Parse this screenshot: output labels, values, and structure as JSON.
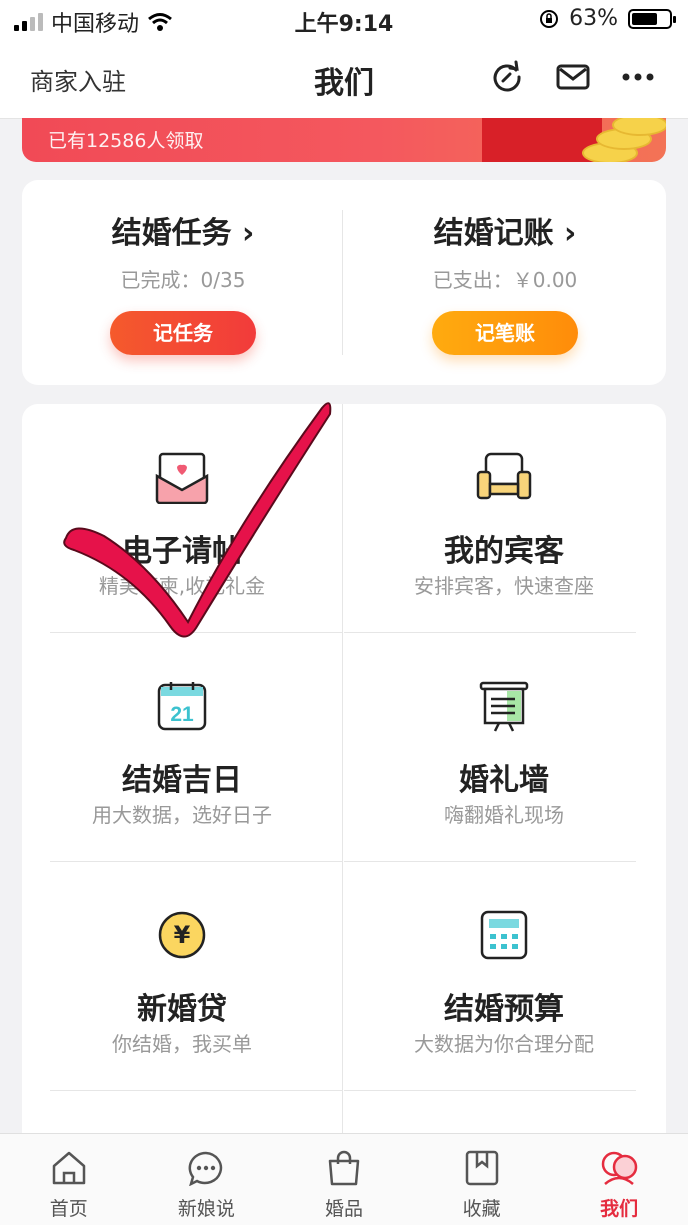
{
  "status_bar": {
    "carrier": "中国移动",
    "time": "上午9:14",
    "battery": "63%"
  },
  "nav": {
    "merchant": "商家入驻",
    "title": "我们"
  },
  "banner": {
    "text": "已有12586人领取"
  },
  "tasks": [
    {
      "title": "结婚任务",
      "sub": "已完成：0/35",
      "button": "记任务"
    },
    {
      "title": "结婚记账",
      "sub": "已支出：￥0.00",
      "button": "记笔账"
    }
  ],
  "grid": [
    {
      "title": "电子请帖",
      "sub": "精美请柬,收礼礼金",
      "icon": "invitation-envelope-icon"
    },
    {
      "title": "我的宾客",
      "sub": "安排宾客，快速查座",
      "icon": "sofa-chair-icon"
    },
    {
      "title": "结婚吉日",
      "sub": "用大数据，选好日子",
      "icon": "calendar-21-icon",
      "icon_text": "21"
    },
    {
      "title": "婚礼墙",
      "sub": "嗨翻婚礼现场",
      "icon": "wedding-wall-screen-icon"
    },
    {
      "title": "新婚贷",
      "sub": "你结婚，我买单",
      "icon": "yen-coin-icon",
      "icon_text": "¥"
    },
    {
      "title": "结婚预算",
      "sub": "大数据为你合理分配",
      "icon": "calculator-icon"
    }
  ],
  "tabbar": [
    {
      "label": "首页",
      "icon": "home-icon"
    },
    {
      "label": "新娘说",
      "icon": "chat-bubble-icon"
    },
    {
      "label": "婚品",
      "icon": "shopping-bag-icon"
    },
    {
      "label": "收藏",
      "icon": "bookmark-icon"
    },
    {
      "label": "我们",
      "icon": "couple-icon",
      "active": true
    }
  ],
  "colors": {
    "accent": "#e52c3f",
    "task_btn_1": "#f44d2e",
    "task_btn_2": "#ffa10a",
    "checkmark": "#e6124a"
  }
}
